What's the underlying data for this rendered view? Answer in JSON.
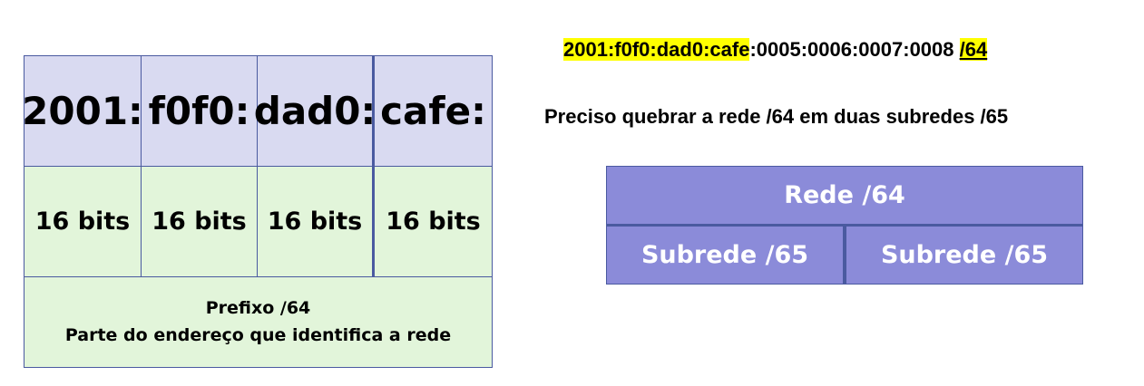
{
  "left_table": {
    "hex_groups": [
      "2001:",
      "f0f0:",
      "dad0:",
      "cafe:"
    ],
    "bit_labels": [
      "16 bits",
      "16 bits",
      "16 bits",
      "16 bits"
    ],
    "prefix_title": "Prefixo /64",
    "prefix_description": "Parte do endereço que identifica a rede"
  },
  "address": {
    "network_part": "2001:f0f0:dad0:cafe",
    "host_part": ":0005:0006:0007:0008 ",
    "prefix_length": "/64"
  },
  "statement": "Preciso quebrar a rede /64 em duas subredes /65",
  "subnet_diagram": {
    "network_label": "Rede /64",
    "subnets": [
      "Subrede /65",
      "Subrede /65"
    ]
  },
  "colors": {
    "highlight": "#ffff00",
    "hex_row_bg": "#d9daf1",
    "bits_row_bg": "#e2f5da",
    "subnet_box_bg": "#8b8bd9",
    "border": "#4a5aa0"
  }
}
